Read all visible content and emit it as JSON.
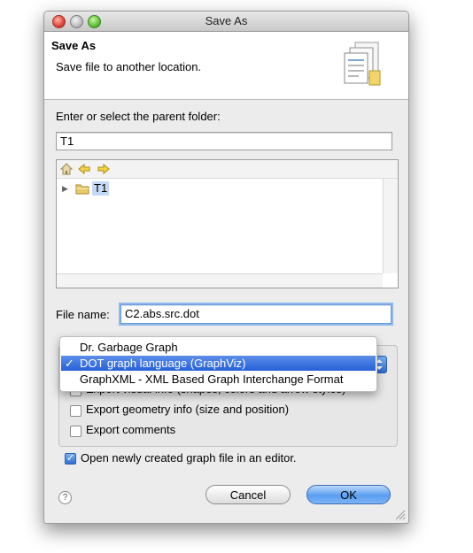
{
  "window": {
    "title": "Save As"
  },
  "header": {
    "title": "Save As",
    "subtitle": "Save file to another location."
  },
  "folder": {
    "label": "Enter or select the parent folder:",
    "value": "T1"
  },
  "tree": {
    "items": [
      {
        "label": "T1",
        "selected": true
      }
    ]
  },
  "file": {
    "label": "File name:",
    "value": "C2.abs.src.dot"
  },
  "format_select": {
    "options": [
      "Dr. Garbage Graph",
      "DOT graph language (GraphViz)",
      "GraphXML - XML Based Graph Interchange Format"
    ],
    "selected_index": 1,
    "check_mark": "✓"
  },
  "options": {
    "visual_info": {
      "label": "Export visual info (shapes, colors and arrow styles)",
      "checked": false
    },
    "geometry_info": {
      "label": "Export geometry info (size and position)",
      "checked": false
    },
    "comments": {
      "label": "Export comments",
      "checked": false
    }
  },
  "open_in_editor": {
    "label": "Open newly created graph file in an editor.",
    "checked": true
  },
  "buttons": {
    "cancel": "Cancel",
    "ok": "OK",
    "help": "?"
  },
  "colors": {
    "accent": "#2560d8",
    "selection": "#c5d9f5"
  }
}
